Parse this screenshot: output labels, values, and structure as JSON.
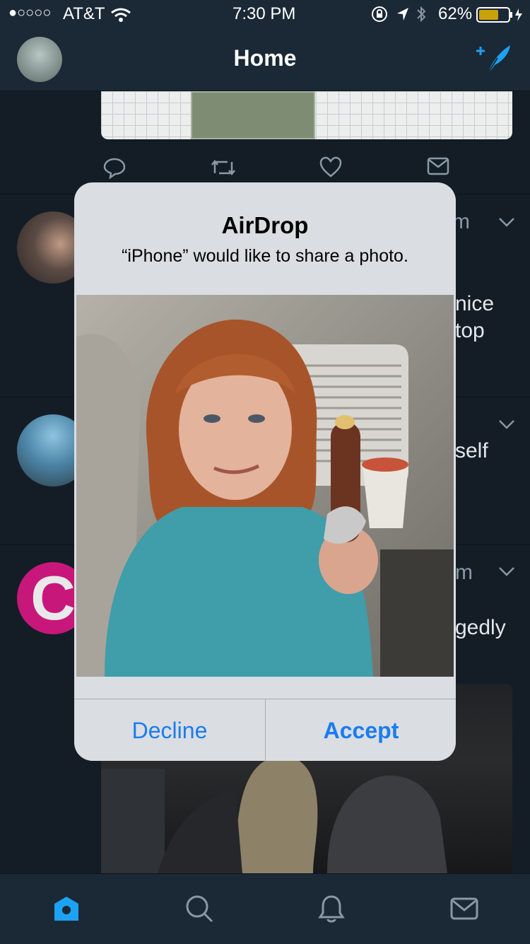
{
  "status_bar": {
    "signal": "●○○○○",
    "carrier": "AT&T",
    "time": "7:30 PM",
    "battery": "62%"
  },
  "nav": {
    "title": "Home"
  },
  "feed": {
    "snippets": [
      "m",
      "nice",
      "top",
      "self",
      "m",
      "gedly"
    ],
    "avatar_letter": "C"
  },
  "airdrop": {
    "title": "AirDrop",
    "message": "“iPhone” would like to share a photo.",
    "decline": "Decline",
    "accept": "Accept"
  },
  "tabbar": {
    "items": [
      "home-tab",
      "search-tab",
      "notifications-tab",
      "messages-tab"
    ]
  },
  "colors": {
    "background": "#141d26",
    "bar": "#1b2836",
    "accent": "#1da1f2",
    "alert_button": "#1a7cf0"
  }
}
